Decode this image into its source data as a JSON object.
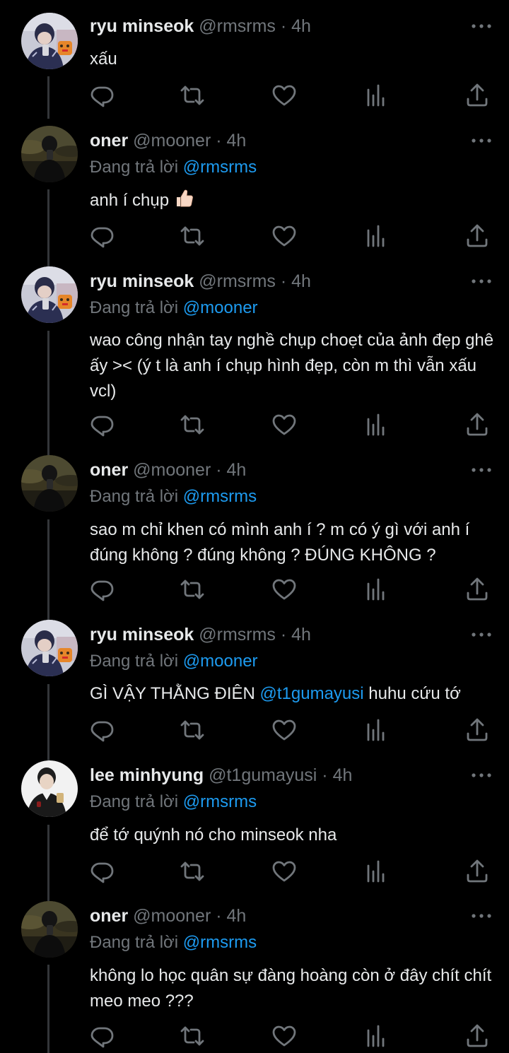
{
  "reply_prefix": "Đang trả lời",
  "icons": {
    "reply": "reply-icon",
    "retweet": "retweet-icon",
    "like": "heart-icon",
    "views": "views-icon",
    "share": "share-icon",
    "more": "more-icon"
  },
  "colors": {
    "accent": "#1d9bf0",
    "muted": "#71767b",
    "text": "#e7e9ea",
    "background": "#000000"
  },
  "tweets": [
    {
      "name": "ryu minseok",
      "handle": "@rmsrms",
      "time": "4h",
      "text": "xấu"
    },
    {
      "name": "oner",
      "handle": "@mooner",
      "time": "4h",
      "reply_to": "@rmsrms",
      "text": "anh í chụp",
      "emoji": "thumbs-up"
    },
    {
      "name": "ryu minseok",
      "handle": "@rmsrms",
      "time": "4h",
      "reply_to": "@mooner",
      "text": "wao công nhận tay nghề chụp choẹt của ảnh đẹp ghê ấy >< (ý t là anh í chụp hình đẹp, còn m thì vẫn xấu vcl)"
    },
    {
      "name": "oner",
      "handle": "@mooner",
      "time": "4h",
      "reply_to": "@rmsrms",
      "text": "sao m chỉ khen có mình anh í ? m có ý gì với anh í đúng không ? đúng không ? ĐÚNG KHÔNG ?"
    },
    {
      "name": "ryu minseok",
      "handle": "@rmsrms",
      "time": "4h",
      "reply_to": "@mooner",
      "text_before": "GÌ VẬY THẰNG ĐIÊN",
      "text_mention": "@t1gumayusi",
      "text_after": "huhu cứu tớ"
    },
    {
      "name": "lee minhyung",
      "handle": "@t1gumayusi",
      "time": "4h",
      "reply_to": "@rmsrms",
      "text": "để tớ quýnh nó cho minseok nha"
    },
    {
      "name": "oner",
      "handle": "@mooner",
      "time": "4h",
      "reply_to": "@rmsrms",
      "text": "không lo học quân sự đàng hoàng còn ở đây chít chít meo meo ???"
    }
  ]
}
